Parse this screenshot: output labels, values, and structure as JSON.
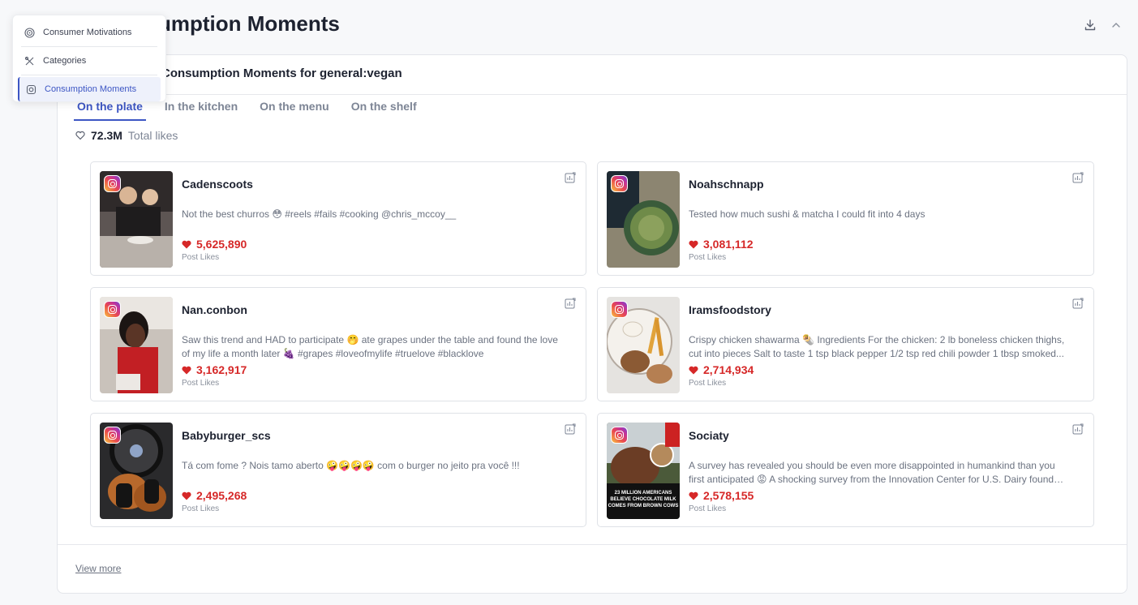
{
  "page": {
    "title": "Consumption Moments",
    "download_icon": "download-icon",
    "collapse_icon": "chevron-up-icon"
  },
  "menu": {
    "items": [
      {
        "label": "Consumer Motivations",
        "icon": "target-icon"
      },
      {
        "label": "Categories",
        "icon": "utensils-icon"
      },
      {
        "label": "Consumption Moments",
        "icon": "instagram-icon",
        "active": true
      }
    ]
  },
  "panel": {
    "heading": "Consumption Moments for general:vegan",
    "tabs": [
      "On the plate",
      "In the kitchen",
      "On the menu",
      "On the shelf"
    ],
    "active_tab": "On the plate",
    "total_likes_value": "72.3M",
    "total_likes_label": "Total likes",
    "view_more": "View more"
  },
  "posts": [
    {
      "name": "Cadenscoots",
      "caption": "Not the best churros 😳  #reels #fails #cooking @chris_mccoy__",
      "likes": "5,625,890",
      "likes_label": "Post Likes"
    },
    {
      "name": "Noahschnapp",
      "caption": "Tested how much sushi & matcha I could fit into 4 days",
      "likes": "3,081,112",
      "likes_label": "Post Likes"
    },
    {
      "name": "Nan.conbon",
      "caption": "Saw this trend and HAD to participate 🤭 ate grapes under the table and found the love of my life a month later 🍇 #grapes #loveofmylife #truelove #blacklove",
      "likes": "3,162,917",
      "likes_label": "Post Likes"
    },
    {
      "name": "Iramsfoodstory",
      "caption": "Crispy chicken shawarma 🌯 Ingredients For the chicken: 2 lb boneless chicken thighs, cut into pieces Salt to taste 1 tsp black pepper 1/2 tsp red chili powder 1 tbsp smoked...",
      "likes": "2,714,934",
      "likes_label": "Post Likes"
    },
    {
      "name": "Babyburger_scs",
      "caption": "Tá com fome ? Nois tamo aberto 🤪🤪🤪🤪 com o burger no jeito pra você !!!",
      "likes": "2,495,268",
      "likes_label": "Post Likes"
    },
    {
      "name": "Sociaty",
      "caption": "A survey has revealed you should be even more disappointed in humankind than you first anticipated 😡  A shocking survey from the Innovation Center for U.S. Dairy found that...",
      "likes": "2,578,155",
      "likes_label": "Post Likes",
      "thumb_text": "23 MILLION AMERICANS BELIEVE CHOCOLATE MILK COMES FROM BROWN COWS"
    }
  ]
}
